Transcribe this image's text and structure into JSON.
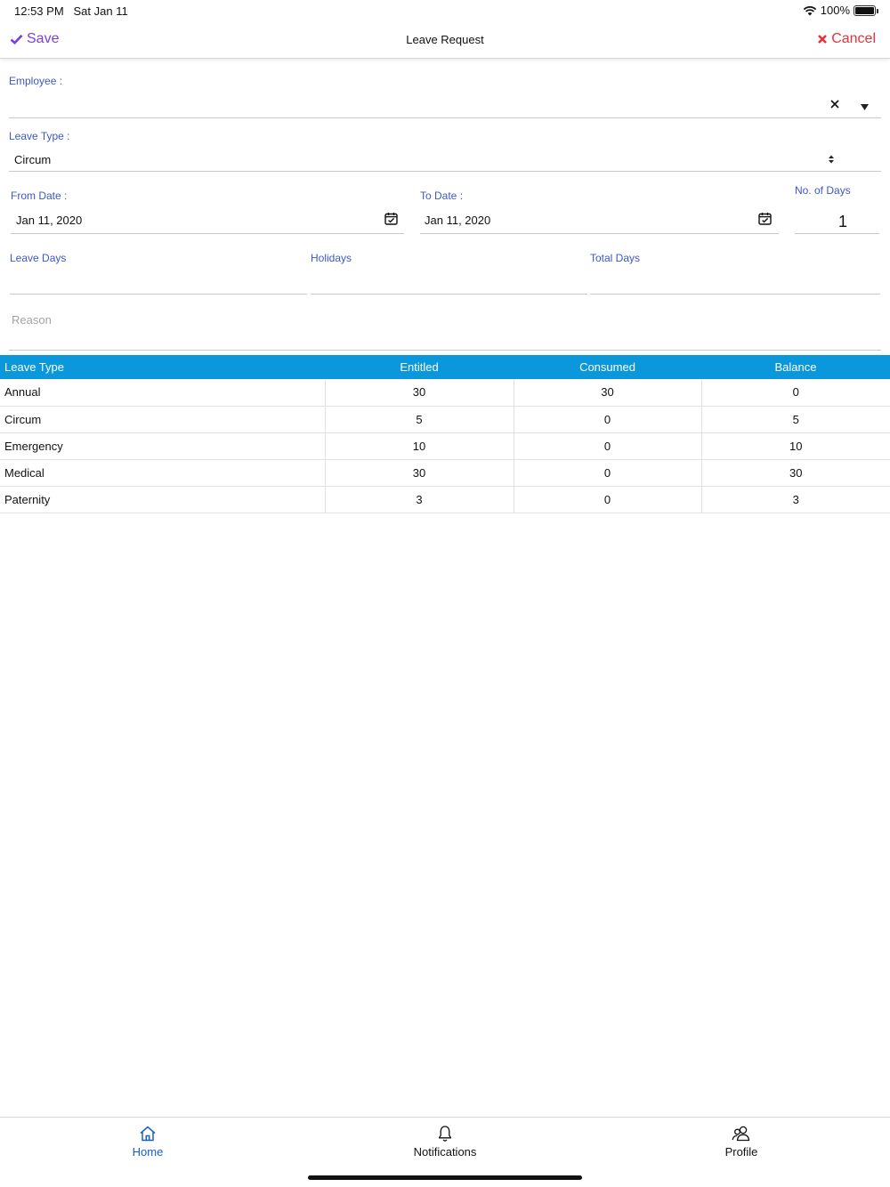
{
  "status_bar": {
    "time": "12:53 PM",
    "date": "Sat Jan 11",
    "battery": "100%"
  },
  "nav": {
    "save_label": "Save",
    "title": "Leave Request",
    "cancel_label": "Cancel"
  },
  "form": {
    "employee_label": "Employee :",
    "employee_value": "",
    "leave_type_label": "Leave Type :",
    "leave_type_value": "Circum",
    "from_date_label": "From Date :",
    "from_date_value": "Jan 11, 2020",
    "to_date_label": "To Date :",
    "to_date_value": "Jan 11, 2020",
    "no_of_days_label": "No. of Days",
    "no_of_days_value": "1",
    "leave_days_label": "Leave Days",
    "holidays_label": "Holidays",
    "total_days_label": "Total Days",
    "reason_placeholder": "Reason"
  },
  "table": {
    "headers": [
      "Leave Type",
      "Entitled",
      "Consumed",
      "Balance"
    ],
    "rows": [
      [
        "Annual",
        "30",
        "30",
        "0"
      ],
      [
        "Circum",
        "5",
        "0",
        "5"
      ],
      [
        "Emergency",
        "10",
        "0",
        "10"
      ],
      [
        "Medical",
        "30",
        "0",
        "30"
      ],
      [
        "Paternity",
        "3",
        "0",
        "3"
      ]
    ]
  },
  "tabs": [
    {
      "label": "Home",
      "icon": "home-icon",
      "active": true
    },
    {
      "label": "Notifications",
      "icon": "bell-icon",
      "active": false
    },
    {
      "label": "Profile",
      "icon": "people-icon",
      "active": false
    }
  ],
  "colors": {
    "accent_purple": "#7b3fe0",
    "cancel_red": "#e8323a",
    "label_blue": "#3d58c6",
    "table_header": "#0a97dc",
    "active_tab": "#1a5ec8"
  }
}
